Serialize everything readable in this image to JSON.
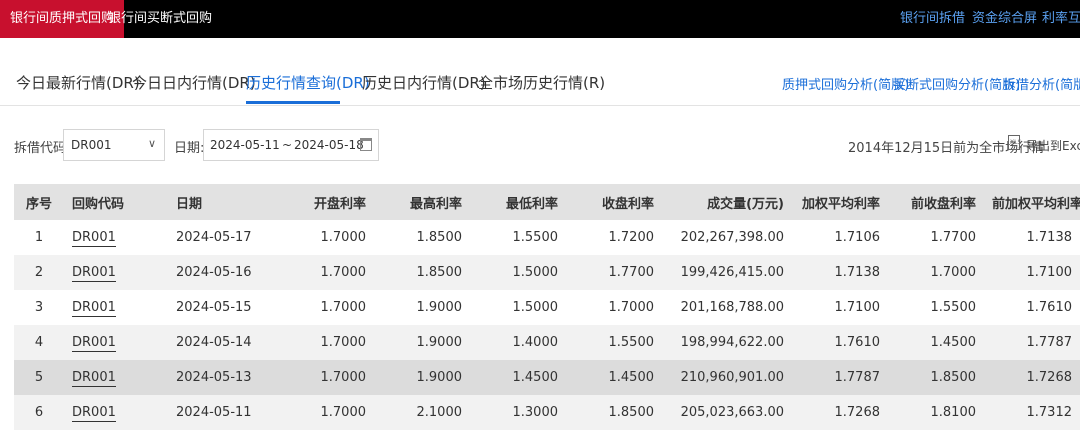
{
  "topbar": {
    "tabs": [
      "银行间质押式回购",
      "银行间买断式回购"
    ],
    "links": [
      "银行间拆借",
      "资金综合屏",
      "利率互换"
    ]
  },
  "tabs": [
    "今日最新行情(DR)",
    "今日日内行情(DR)",
    "历史行情查询(DR)",
    "历史日内行情(DR)",
    "全市场历史行情(R)"
  ],
  "active_tab": "历史行情查询(DR)",
  "analysis_links": [
    "质押式回购分析(简版)",
    "买断式回购分析(简版)",
    "拆借分析(简版)"
  ],
  "filter": {
    "code_label": "拆借代码:",
    "code_value": "DR001",
    "date_label": "日期:",
    "date_start": "2024-05-11",
    "date_sep": "~",
    "date_end": "2024-05-18",
    "note": "2014年12月15日前为全市场行情",
    "export_label": "导出到Excel",
    "export_icon_text": "XLS"
  },
  "table": {
    "headers": [
      "序号",
      "回购代码",
      "日期",
      "开盘利率",
      "最高利率",
      "最低利率",
      "收盘利率",
      "成交量(万元)",
      "加权平均利率",
      "前收盘利率",
      "前加权平均利率"
    ],
    "rows": [
      [
        "1",
        "DR001",
        "2024-05-17",
        "1.7000",
        "1.8500",
        "1.5500",
        "1.7200",
        "202,267,398.00",
        "1.7106",
        "1.7700",
        "1.7138"
      ],
      [
        "2",
        "DR001",
        "2024-05-16",
        "1.7000",
        "1.8500",
        "1.5000",
        "1.7700",
        "199,426,415.00",
        "1.7138",
        "1.7000",
        "1.7100"
      ],
      [
        "3",
        "DR001",
        "2024-05-15",
        "1.7000",
        "1.9000",
        "1.5000",
        "1.7000",
        "201,168,788.00",
        "1.7100",
        "1.5500",
        "1.7610"
      ],
      [
        "4",
        "DR001",
        "2024-05-14",
        "1.7000",
        "1.9000",
        "1.4000",
        "1.5500",
        "198,994,622.00",
        "1.7610",
        "1.4500",
        "1.7787"
      ],
      [
        "5",
        "DR001",
        "2024-05-13",
        "1.7000",
        "1.9000",
        "1.4500",
        "1.4500",
        "210,960,901.00",
        "1.7787",
        "1.8500",
        "1.7268"
      ],
      [
        "6",
        "DR001",
        "2024-05-11",
        "1.7000",
        "2.1000",
        "1.3000",
        "1.8500",
        "205,023,663.00",
        "1.7268",
        "1.8100",
        "1.7312"
      ]
    ],
    "highlighted_row": 5
  },
  "colors": {
    "active_top_tab": "#c8102e",
    "accent_blue": "#1a6ed8",
    "top_link_blue": "#5aa0f0"
  }
}
